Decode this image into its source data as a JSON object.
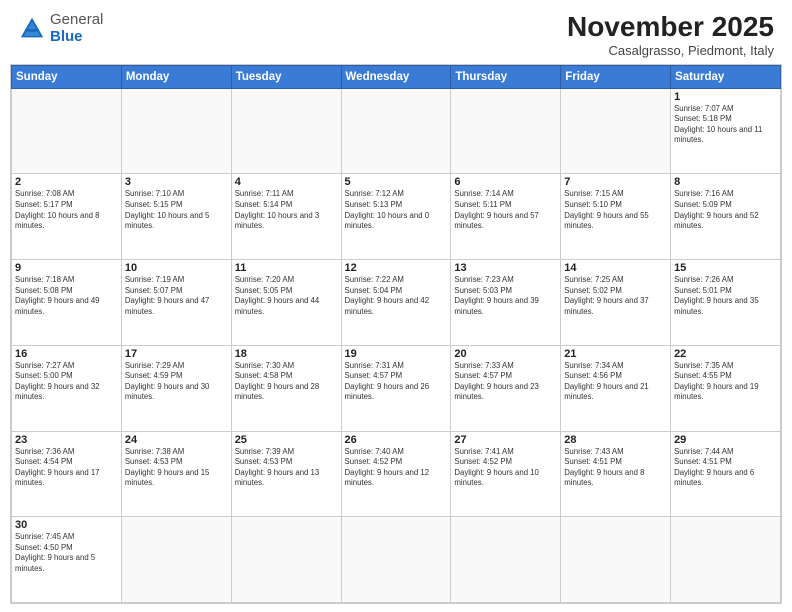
{
  "header": {
    "logo_general": "General",
    "logo_blue": "Blue",
    "month_title": "November 2025",
    "subtitle": "Casalgrasso, Piedmont, Italy"
  },
  "days_of_week": [
    "Sunday",
    "Monday",
    "Tuesday",
    "Wednesday",
    "Thursday",
    "Friday",
    "Saturday"
  ],
  "weeks": [
    [
      {
        "day": "",
        "info": ""
      },
      {
        "day": "",
        "info": ""
      },
      {
        "day": "",
        "info": ""
      },
      {
        "day": "",
        "info": ""
      },
      {
        "day": "",
        "info": ""
      },
      {
        "day": "",
        "info": ""
      },
      {
        "day": "1",
        "info": "Sunrise: 7:07 AM\nSunset: 5:18 PM\nDaylight: 10 hours and 11 minutes."
      }
    ],
    [
      {
        "day": "2",
        "info": "Sunrise: 7:08 AM\nSunset: 5:17 PM\nDaylight: 10 hours and 8 minutes."
      },
      {
        "day": "3",
        "info": "Sunrise: 7:10 AM\nSunset: 5:15 PM\nDaylight: 10 hours and 5 minutes."
      },
      {
        "day": "4",
        "info": "Sunrise: 7:11 AM\nSunset: 5:14 PM\nDaylight: 10 hours and 3 minutes."
      },
      {
        "day": "5",
        "info": "Sunrise: 7:12 AM\nSunset: 5:13 PM\nDaylight: 10 hours and 0 minutes."
      },
      {
        "day": "6",
        "info": "Sunrise: 7:14 AM\nSunset: 5:11 PM\nDaylight: 9 hours and 57 minutes."
      },
      {
        "day": "7",
        "info": "Sunrise: 7:15 AM\nSunset: 5:10 PM\nDaylight: 9 hours and 55 minutes."
      },
      {
        "day": "8",
        "info": "Sunrise: 7:16 AM\nSunset: 5:09 PM\nDaylight: 9 hours and 52 minutes."
      }
    ],
    [
      {
        "day": "9",
        "info": "Sunrise: 7:18 AM\nSunset: 5:08 PM\nDaylight: 9 hours and 49 minutes."
      },
      {
        "day": "10",
        "info": "Sunrise: 7:19 AM\nSunset: 5:07 PM\nDaylight: 9 hours and 47 minutes."
      },
      {
        "day": "11",
        "info": "Sunrise: 7:20 AM\nSunset: 5:05 PM\nDaylight: 9 hours and 44 minutes."
      },
      {
        "day": "12",
        "info": "Sunrise: 7:22 AM\nSunset: 5:04 PM\nDaylight: 9 hours and 42 minutes."
      },
      {
        "day": "13",
        "info": "Sunrise: 7:23 AM\nSunset: 5:03 PM\nDaylight: 9 hours and 39 minutes."
      },
      {
        "day": "14",
        "info": "Sunrise: 7:25 AM\nSunset: 5:02 PM\nDaylight: 9 hours and 37 minutes."
      },
      {
        "day": "15",
        "info": "Sunrise: 7:26 AM\nSunset: 5:01 PM\nDaylight: 9 hours and 35 minutes."
      }
    ],
    [
      {
        "day": "16",
        "info": "Sunrise: 7:27 AM\nSunset: 5:00 PM\nDaylight: 9 hours and 32 minutes."
      },
      {
        "day": "17",
        "info": "Sunrise: 7:29 AM\nSunset: 4:59 PM\nDaylight: 9 hours and 30 minutes."
      },
      {
        "day": "18",
        "info": "Sunrise: 7:30 AM\nSunset: 4:58 PM\nDaylight: 9 hours and 28 minutes."
      },
      {
        "day": "19",
        "info": "Sunrise: 7:31 AM\nSunset: 4:57 PM\nDaylight: 9 hours and 26 minutes."
      },
      {
        "day": "20",
        "info": "Sunrise: 7:33 AM\nSunset: 4:57 PM\nDaylight: 9 hours and 23 minutes."
      },
      {
        "day": "21",
        "info": "Sunrise: 7:34 AM\nSunset: 4:56 PM\nDaylight: 9 hours and 21 minutes."
      },
      {
        "day": "22",
        "info": "Sunrise: 7:35 AM\nSunset: 4:55 PM\nDaylight: 9 hours and 19 minutes."
      }
    ],
    [
      {
        "day": "23",
        "info": "Sunrise: 7:36 AM\nSunset: 4:54 PM\nDaylight: 9 hours and 17 minutes."
      },
      {
        "day": "24",
        "info": "Sunrise: 7:38 AM\nSunset: 4:53 PM\nDaylight: 9 hours and 15 minutes."
      },
      {
        "day": "25",
        "info": "Sunrise: 7:39 AM\nSunset: 4:53 PM\nDaylight: 9 hours and 13 minutes."
      },
      {
        "day": "26",
        "info": "Sunrise: 7:40 AM\nSunset: 4:52 PM\nDaylight: 9 hours and 12 minutes."
      },
      {
        "day": "27",
        "info": "Sunrise: 7:41 AM\nSunset: 4:52 PM\nDaylight: 9 hours and 10 minutes."
      },
      {
        "day": "28",
        "info": "Sunrise: 7:43 AM\nSunset: 4:51 PM\nDaylight: 9 hours and 8 minutes."
      },
      {
        "day": "29",
        "info": "Sunrise: 7:44 AM\nSunset: 4:51 PM\nDaylight: 9 hours and 6 minutes."
      }
    ],
    [
      {
        "day": "30",
        "info": "Sunrise: 7:45 AM\nSunset: 4:50 PM\nDaylight: 9 hours and 5 minutes."
      },
      {
        "day": "",
        "info": ""
      },
      {
        "day": "",
        "info": ""
      },
      {
        "day": "",
        "info": ""
      },
      {
        "day": "",
        "info": ""
      },
      {
        "day": "",
        "info": ""
      },
      {
        "day": "",
        "info": ""
      }
    ]
  ]
}
